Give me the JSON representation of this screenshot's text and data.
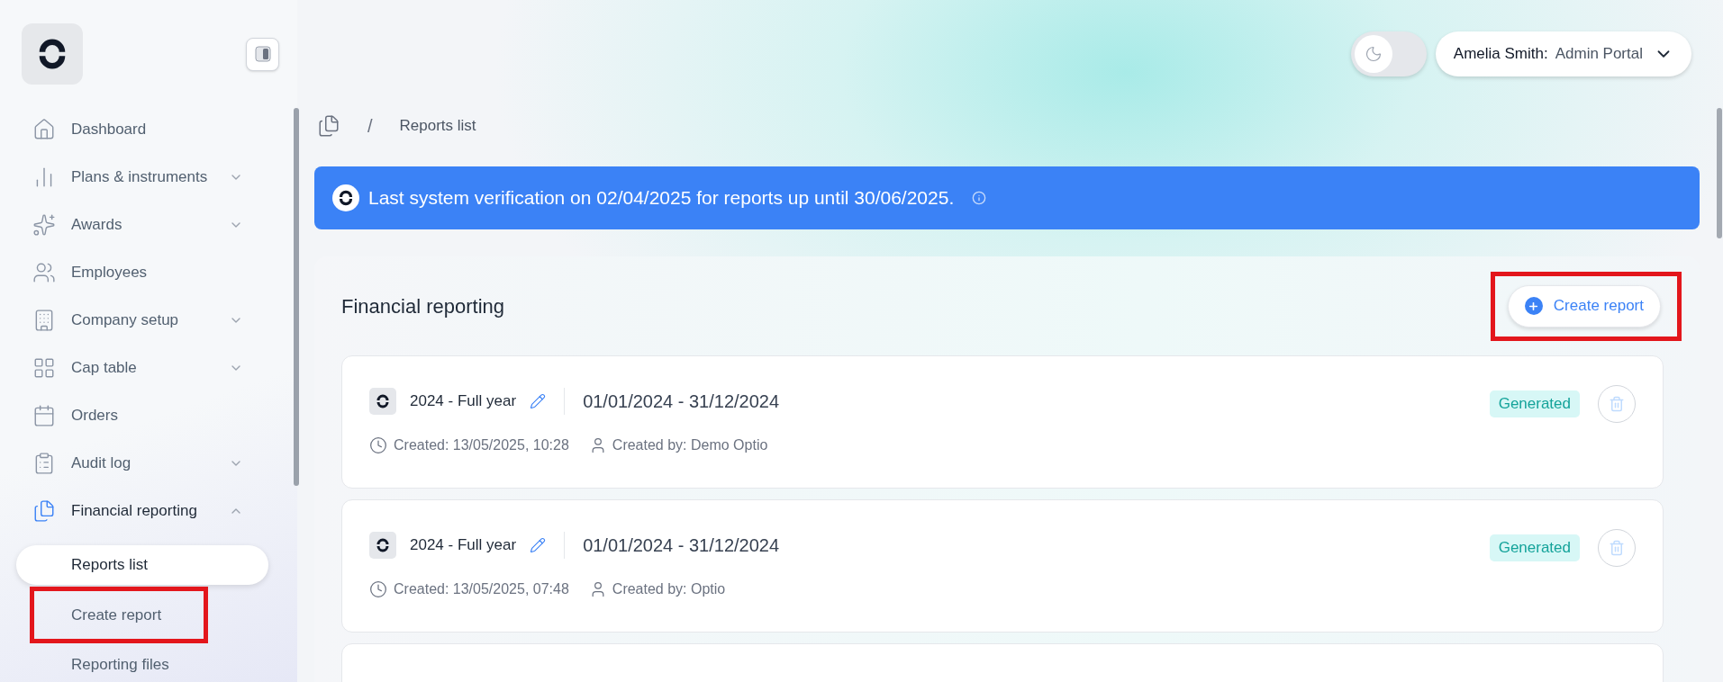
{
  "sidebar": {
    "items": [
      {
        "label": "Dashboard",
        "expandable": false,
        "selected": false
      },
      {
        "label": "Plans & instruments",
        "expandable": true,
        "expanded": false,
        "selected": false
      },
      {
        "label": "Awards",
        "expandable": true,
        "expanded": false,
        "selected": false
      },
      {
        "label": "Employees",
        "expandable": false,
        "selected": false
      },
      {
        "label": "Company setup",
        "expandable": true,
        "expanded": false,
        "selected": false
      },
      {
        "label": "Cap table",
        "expandable": true,
        "expanded": false,
        "selected": false
      },
      {
        "label": "Orders",
        "expandable": false,
        "selected": false
      },
      {
        "label": "Audit log",
        "expandable": true,
        "expanded": false,
        "selected": false
      },
      {
        "label": "Financial reporting",
        "expandable": true,
        "expanded": true,
        "selected": true,
        "children": [
          {
            "label": "Reports list",
            "selected": true,
            "highlighted": false
          },
          {
            "label": "Create report",
            "selected": false,
            "highlighted": true
          },
          {
            "label": "Reporting files",
            "selected": false,
            "highlighted": false
          }
        ]
      }
    ]
  },
  "header": {
    "dark_mode": false,
    "user": "Amelia Smith:",
    "portal": "Admin Portal"
  },
  "breadcrumb": {
    "separator": "/",
    "current": "Reports list"
  },
  "banner": {
    "text": "Last system verification on 02/04/2025 for reports up until 30/06/2025."
  },
  "panel": {
    "title": "Financial reporting",
    "create_button": {
      "label": "Create report",
      "highlighted": true
    },
    "reports": [
      {
        "title": "2024 - Full year",
        "period": "01/01/2024 - 31/12/2024",
        "created": "Created: 13/05/2025, 10:28",
        "created_by": "Created by: Demo Optio",
        "status": "Generated"
      },
      {
        "title": "2024 - Full year",
        "period": "01/01/2024 - 31/12/2024",
        "created": "Created: 13/05/2025, 07:48",
        "created_by": "Created by: Optio",
        "status": "Generated"
      }
    ]
  }
}
